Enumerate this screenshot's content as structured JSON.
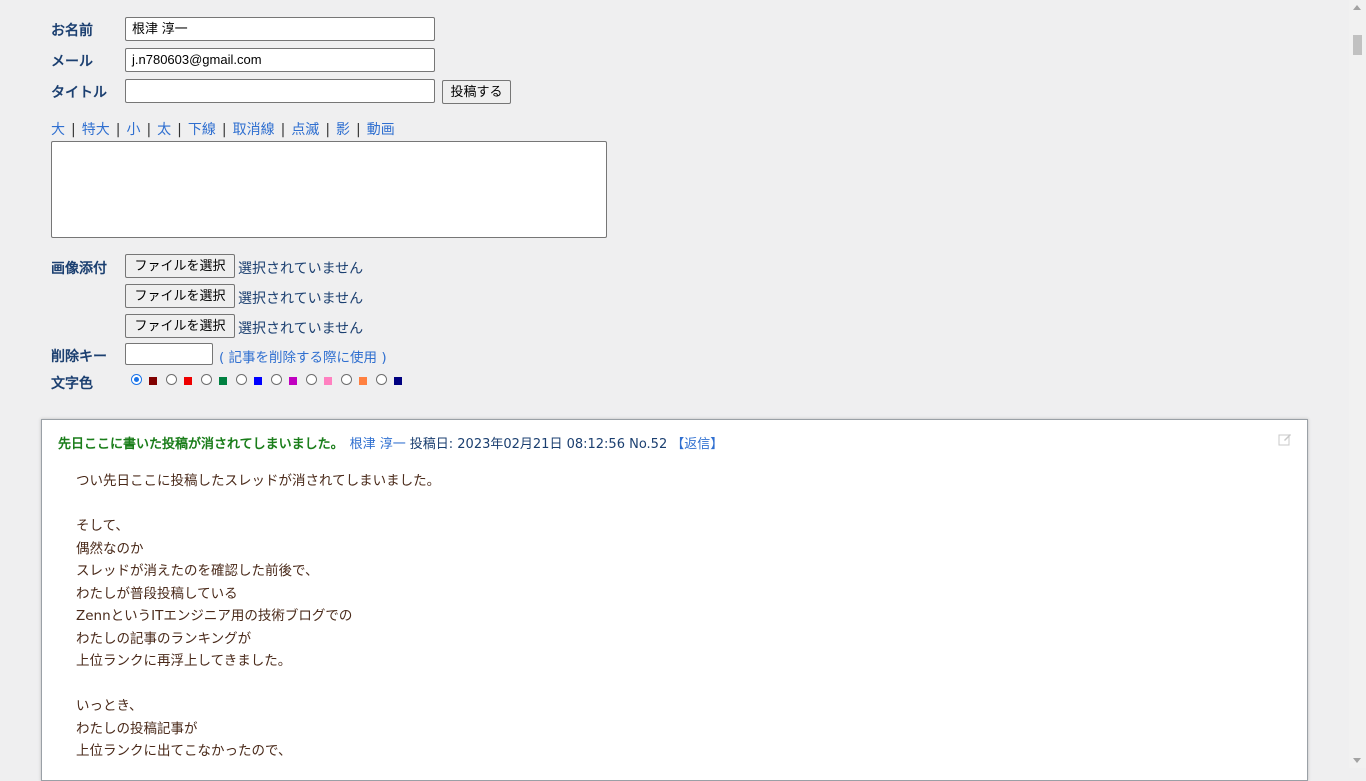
{
  "form": {
    "name_label": "お名前",
    "name_value": "根津 淳一",
    "mail_label": "メール",
    "mail_value": "j.n780603@gmail.com",
    "title_label": "タイトル",
    "title_value": "",
    "submit_label": "投稿する",
    "decorations": [
      "大",
      "特大",
      "小",
      "太",
      "下線",
      "取消線",
      "点滅",
      "影",
      "動画"
    ],
    "separator": "|",
    "message_value": "",
    "image_label": "画像添付",
    "file_button_label": "ファイルを選択",
    "file_none_text": "選択されていません",
    "delete_key_label": "削除キー",
    "delete_key_value": "",
    "delete_key_note": "( 記事を削除する際に使用 )",
    "color_label": "文字色",
    "colors": [
      "#800000",
      "#ee0000",
      "#008040",
      "#0000ff",
      "#c000c0",
      "#ff80c0",
      "#ff8040",
      "#000080"
    ],
    "selected_color_index": 0
  },
  "post": {
    "title": "先日ここに書いた投稿が消されてしまいました。",
    "author": "根津 淳一",
    "meta": "投稿日: 2023年02月21日 08:12:56 No.52",
    "reply": "【返信】",
    "edit_icon": "edit-icon",
    "body": "つい先日ここに投稿したスレッドが消されてしまいました。\n\nそして、\n偶然なのか\nスレッドが消えたのを確認した前後で、\nわたしが普段投稿している\nZennというITエンジニア用の技術ブログでの\nわたしの記事のランキングが\n上位ランクに再浮上してきました。\n\nいっとき、\nわたしの投稿記事が\n上位ランクに出てこなかったので、"
  }
}
